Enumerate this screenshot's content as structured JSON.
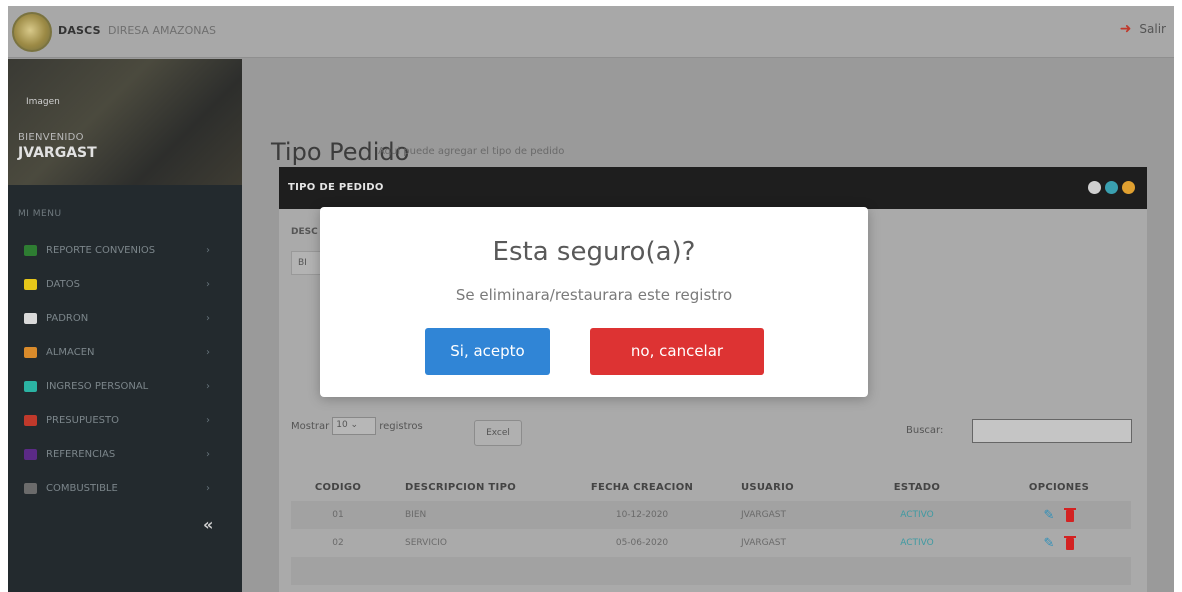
{
  "header": {
    "brand": "DASCS",
    "brand_sub": "DIRESA AMAZONAS",
    "logout_label": "Salir"
  },
  "sidebar": {
    "profile_image_label": "Imagen",
    "welcome": "BIENVENIDO",
    "username": "JVARGAST",
    "menu_title": "MI MENU",
    "items": [
      {
        "label": "REPORTE CONVENIOS",
        "icon": "check-icon",
        "color": "#2e7d32"
      },
      {
        "label": "DATOS",
        "icon": "database-icon",
        "color": "#e6c619"
      },
      {
        "label": "PADRON",
        "icon": "table-icon",
        "color": "#d9d9d9"
      },
      {
        "label": "ALMACEN",
        "icon": "boxes-icon",
        "color": "#d98b2b"
      },
      {
        "label": "INGRESO PERSONAL",
        "icon": "users-icon",
        "color": "#2bb3a3"
      },
      {
        "label": "PRESUPUESTO",
        "icon": "money-icon",
        "color": "#c0392b"
      },
      {
        "label": "REFERENCIAS",
        "icon": "list-icon",
        "color": "#5b2a86"
      },
      {
        "label": "COMBUSTIBLE",
        "icon": "gear-icon",
        "color": "#6b6b6b"
      }
    ],
    "collapse": "«"
  },
  "main": {
    "title": "Tipo Pedido",
    "subtitle": "Aqui puede agregar el tipo de pedido",
    "panel_title": "TIPO DE PEDIDO",
    "desc_label": "DESC",
    "desc_value": "BI",
    "show_prefix": "Mostrar",
    "show_value": "10",
    "show_suffix": "registros",
    "excel_label": "Excel",
    "search_label": "Buscar:",
    "columns": [
      "CODIGO",
      "DESCRIPCION TIPO",
      "FECHA CREACION",
      "USUARIO",
      "ESTADO",
      "OPCIONES"
    ],
    "rows": [
      {
        "codigo": "01",
        "descripcion": "BIEN",
        "fecha": "10-12-2020",
        "usuario": "JVARGAST",
        "estado": "ACTIVO"
      },
      {
        "codigo": "02",
        "descripcion": "SERVICIO",
        "fecha": "05-06-2020",
        "usuario": "JVARGAST",
        "estado": "ACTIVO"
      }
    ]
  },
  "modal": {
    "title": "Esta seguro(a)?",
    "text": "Se eliminara/restaurara este registro",
    "confirm_label": "Si, acepto",
    "cancel_label": "no, cancelar"
  }
}
